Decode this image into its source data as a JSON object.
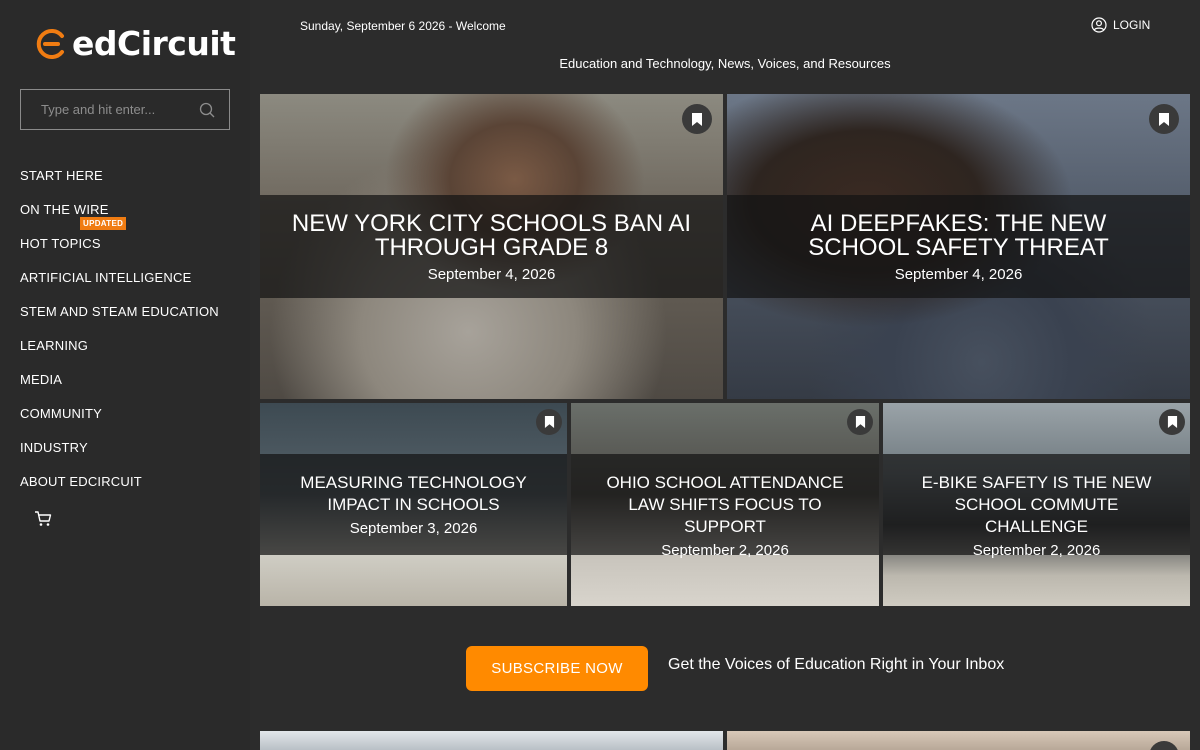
{
  "brand": {
    "name": "edCircuit",
    "accent": "#f07c12"
  },
  "search": {
    "placeholder": "Type and hit enter...",
    "icon": "search-icon"
  },
  "nav": {
    "items": [
      {
        "label": "START HERE"
      },
      {
        "label": "ON THE WIRE"
      },
      {
        "label": "HOT TOPICS",
        "badge": "UPDATED"
      },
      {
        "label": "ARTIFICIAL INTELLIGENCE"
      },
      {
        "label": "STEM AND STEAM EDUCATION"
      },
      {
        "label": "LEARNING"
      },
      {
        "label": "MEDIA"
      },
      {
        "label": "COMMUNITY"
      },
      {
        "label": "INDUSTRY"
      },
      {
        "label": "ABOUT EDCIRCUIT"
      }
    ],
    "cart_icon": "cart-icon"
  },
  "topbar": {
    "date_welcome": "Sunday, September 6 2026 - Welcome",
    "login_label": "LOGIN",
    "tagline": "Education and Technology, News, Voices, and Resources"
  },
  "articles": [
    {
      "title": "NEW YORK CITY SCHOOLS BAN AI THROUGH GRADE 8",
      "date": "September 4, 2026"
    },
    {
      "title": "AI DEEPFAKES: THE NEW SCHOOL SAFETY THREAT",
      "date": "September 4, 2026"
    },
    {
      "title": "MEASURING TECHNOLOGY IMPACT IN SCHOOLS",
      "date": "September 3, 2026"
    },
    {
      "title": "OHIO SCHOOL ATTENDANCE LAW SHIFTS FOCUS TO SUPPORT",
      "date": "September 2, 2026"
    },
    {
      "title": "E-BIKE SAFETY IS THE NEW SCHOOL COMMUTE CHALLENGE",
      "date": "September 2, 2026"
    }
  ],
  "subscribe": {
    "button_label": "SUBSCRIBE NOW",
    "text": "Get the Voices of Education Right in Your Inbox",
    "color": "#ff8a00"
  }
}
